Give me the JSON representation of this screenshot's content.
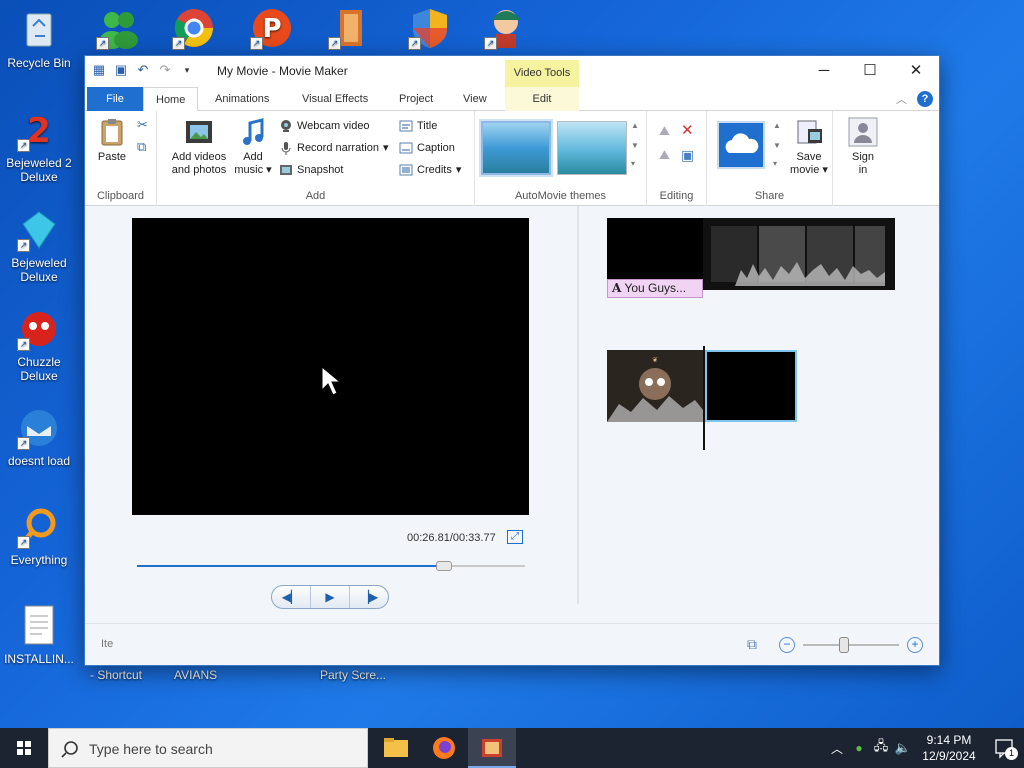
{
  "desktop": {
    "icons": [
      {
        "label": "Recycle Bin"
      },
      {
        "label": "Bejeweled 2 Deluxe"
      },
      {
        "label": "Bejeweled Deluxe"
      },
      {
        "label": "Chuzzle Deluxe"
      },
      {
        "label": "doesnt load"
      },
      {
        "label": "Everything"
      },
      {
        "label": "INSTALLIN..."
      }
    ],
    "bottom_labels": [
      "- Shortcut",
      "AVIANS",
      "Party Scre..."
    ]
  },
  "window": {
    "title": "My Movie - Movie Maker",
    "context_tab_group": "Video Tools",
    "tabs": {
      "file": "File",
      "home": "Home",
      "animations": "Animations",
      "visual_effects": "Visual Effects",
      "project": "Project",
      "view": "View",
      "edit": "Edit"
    },
    "ribbon": {
      "clipboard": {
        "paste": "Paste",
        "label": "Clipboard"
      },
      "add": {
        "add_videos_1": "Add videos",
        "add_videos_2": "and photos",
        "add_music_1": "Add",
        "add_music_2": "music",
        "webcam": "Webcam video",
        "narration": "Record narration",
        "snapshot": "Snapshot",
        "title": "Title",
        "caption": "Caption",
        "credits": "Credits",
        "label": "Add"
      },
      "themes": {
        "label": "AutoMovie themes"
      },
      "editing": {
        "label": "Editing"
      },
      "share": {
        "save_movie_1": "Save",
        "save_movie_2": "movie",
        "label": "Share"
      },
      "sign_in": {
        "line1": "Sign",
        "line2": "in"
      }
    },
    "preview": {
      "timecode": "00:26.81/00:33.77",
      "seek_progress": 0.79
    },
    "storyboard": {
      "caption_text": "You Guys..."
    },
    "status": {
      "text": "Ite"
    }
  },
  "taskbar": {
    "search_placeholder": "Type here to search",
    "time": "9:14 PM",
    "date": "12/9/2024",
    "notification_count": "1"
  }
}
